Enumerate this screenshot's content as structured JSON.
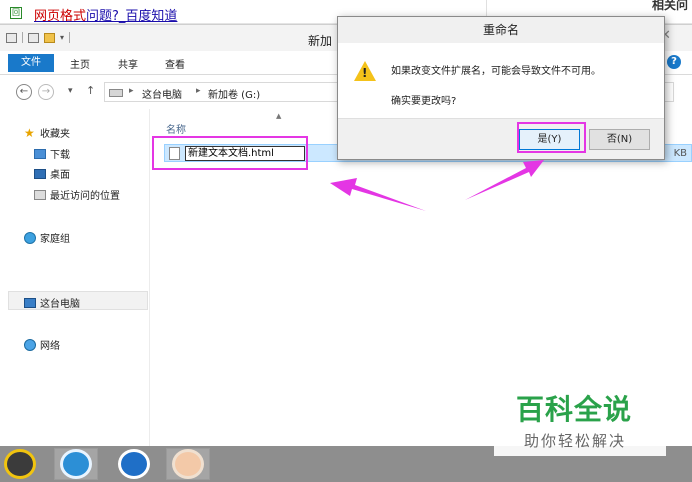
{
  "browser": {
    "link_part1": "网页格式",
    "link_part2": "问题?_百度知道",
    "right_title": "相关问",
    "favicon": "回"
  },
  "explorer": {
    "window_title": "新加",
    "ribbon_tabs": [
      "文件",
      "主页",
      "共享",
      "查看"
    ],
    "address": {
      "crumbs": [
        "这台电脑",
        "新加卷 (G:)"
      ]
    },
    "sidebar": {
      "favorites": "收藏夹",
      "downloads": "下载",
      "desktop": "桌面",
      "recent": "最近访问的位置",
      "homegroup": "家庭组",
      "this_pc": "这台电脑",
      "network": "网络"
    },
    "column_name": "名称",
    "file": {
      "rename_value": "新建文本文档.html",
      "size_suffix": "KB"
    }
  },
  "dialog": {
    "title": "重命名",
    "message": "如果改变文件扩展名，可能会导致文件不可用。",
    "question": "确实要更改吗?",
    "yes_label": "是(Y)",
    "no_label": "否(N)"
  },
  "watermark": {
    "brand": "百科全说",
    "slogan": "助你轻松解决"
  },
  "colors": {
    "highlight": "#e436e4",
    "accent": "#1979ca",
    "watermark_green": "#2aa24a"
  }
}
